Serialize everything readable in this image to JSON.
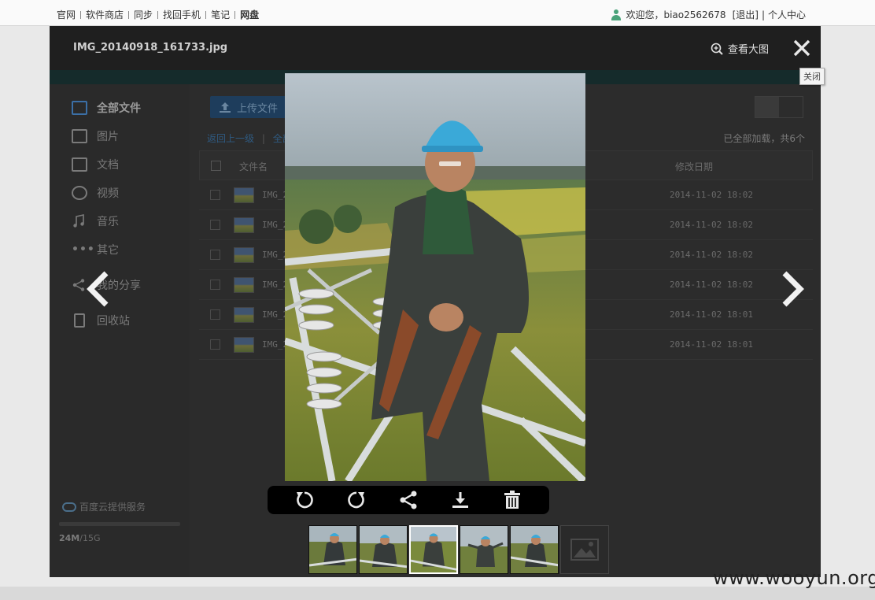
{
  "topnav": {
    "links": [
      "官网",
      "软件商店",
      "同步",
      "找回手机",
      "笔记",
      "网盘"
    ],
    "welcome": "欢迎您，",
    "username": "biao2562678",
    "logout": "[退出]",
    "separator": "|",
    "profile": "个人中心"
  },
  "viewer": {
    "filename": "IMG_20140918_161733.jpg",
    "view_large": "查看大图",
    "close_tooltip": "关闭",
    "zoom_icon": "zoom-in-icon",
    "close_icon": "close-icon",
    "prev_icon": "chevron-left-icon",
    "next_icon": "chevron-right-icon",
    "toolbar_icons": [
      "rotate-left-icon",
      "rotate-right-icon",
      "share-icon",
      "download-icon",
      "delete-icon"
    ],
    "thumbnail_count": 6,
    "selected_thumbnail": 3
  },
  "background_app": {
    "sidebar": [
      "全部文件",
      "图片",
      "文档",
      "视频",
      "音乐",
      "其它",
      "我的分享",
      "回收站"
    ],
    "cloud_service": "百度云提供服务",
    "quota_used": "24M",
    "quota_total": "/15G",
    "upload": "上传文件",
    "back": "返回上一级",
    "crumb_sep": "|",
    "crumb_all": "全部",
    "loaded": "已全部加载，共6个",
    "col_name": "文件名",
    "col_date": "修改日期",
    "files": [
      {
        "name": "IMG_2",
        "date": "2014-11-02 18:02"
      },
      {
        "name": "IMG_2",
        "date": "2014-11-02 18:02"
      },
      {
        "name": "IMG_2",
        "date": "2014-11-02 18:02"
      },
      {
        "name": "IMG_2",
        "date": "2014-11-02 18:02"
      },
      {
        "name": "IMG_2",
        "date": "2014-11-02 18:01"
      },
      {
        "name": "IMG_2",
        "date": "2014-11-02 18:01"
      }
    ]
  },
  "watermark": "www.wooyun.org",
  "colors": {
    "viewer_bg": "#262626",
    "accent_blue": "#2f5a80",
    "helmet": "#3aa9d8"
  }
}
